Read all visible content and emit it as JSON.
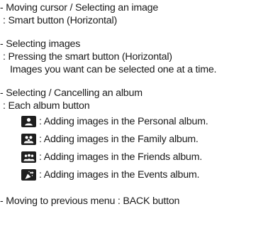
{
  "sections": [
    {
      "heading": "- Moving cursor / Selecting an image",
      "lines": [
        " : Smart button (Horizontal)"
      ]
    },
    {
      "heading": "- Selecting images",
      "lines": [
        " : Pressing the smart button (Horizontal)",
        "Images you want can be selected one at a time."
      ]
    },
    {
      "heading": "- Selecting / Cancelling an album",
      "lines": [
        " : Each album button"
      ],
      "albums": [
        {
          "icon": "personal-album-icon",
          "text": ": Adding images in the Personal album."
        },
        {
          "icon": "family-album-icon",
          "text": ": Adding images in the Family album."
        },
        {
          "icon": "friends-album-icon",
          "text": ": Adding images in the Friends album."
        },
        {
          "icon": "events-album-icon",
          "text": ": Adding images in the Events album."
        }
      ]
    },
    {
      "heading": "- Moving to previous menu : BACK button"
    }
  ],
  "colors": {
    "text": "#1a1a1a",
    "icon_bg": "#1e1e1e",
    "icon_fg": "#ffffff"
  }
}
